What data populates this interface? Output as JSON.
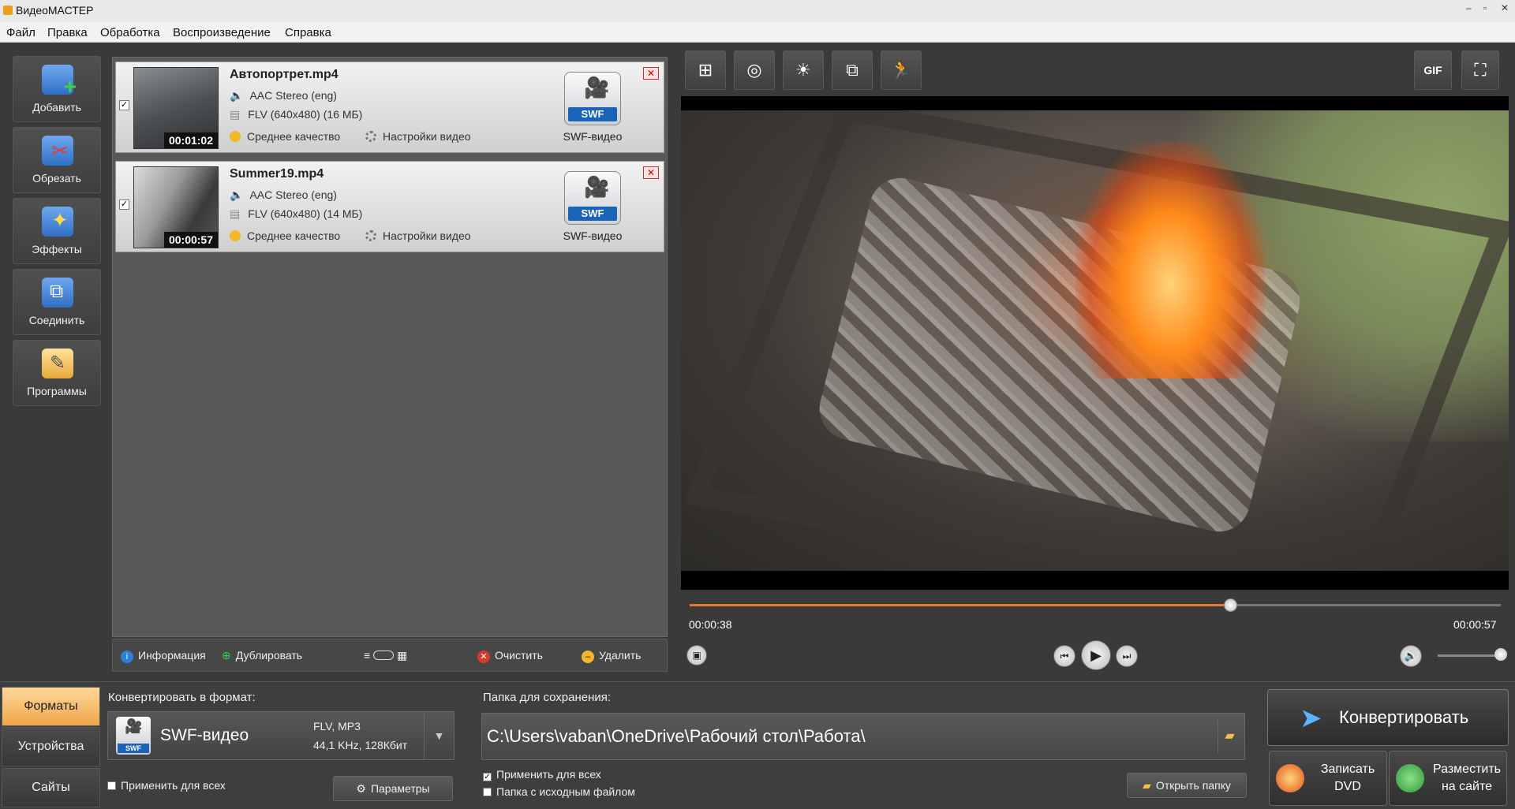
{
  "window": {
    "title": "ВидеоМАСТЕР",
    "controls": [
      "–",
      "▫",
      "✕"
    ]
  },
  "menu": [
    "Файл",
    "Правка",
    "Обработка",
    "Воспроизведение",
    "Справка"
  ],
  "sidebar": [
    {
      "label": "Добавить",
      "icon": "add-video-icon",
      "color": "#3f7fd6"
    },
    {
      "label": "Обрезать",
      "icon": "scissors-icon",
      "color": "#c0392b"
    },
    {
      "label": "Эффекты",
      "icon": "magic-wand-icon",
      "color": "#e0b43a"
    },
    {
      "label": "Соединить",
      "icon": "join-icon",
      "color": "#3f7fd6"
    },
    {
      "label": "Программы",
      "icon": "programs-icon",
      "color": "#f0c040"
    }
  ],
  "files": [
    {
      "name": "Автопортрет.mp4",
      "duration": "00:01:02",
      "audio": "AAC Stereo (eng)",
      "video": "FLV (640x480) (16 МБ)",
      "quality": "Среднее качество",
      "settings": "Настройки видео",
      "format_badge": "SWF",
      "format_label": "SWF-видео",
      "checked": "✓"
    },
    {
      "name": "Summer19.mp4",
      "duration": "00:00:57",
      "audio": "AAC Stereo (eng)",
      "video": "FLV (640x480) (14 МБ)",
      "quality": "Среднее качество",
      "settings": "Настройки видео",
      "format_badge": "SWF",
      "format_label": "SWF-видео",
      "checked": "✓"
    }
  ],
  "listbar": {
    "info": "Информация",
    "duplicate": "Дублировать",
    "clear": "Очистить",
    "delete": "Удалить"
  },
  "player": {
    "tools": [
      "⊞",
      "◎",
      "☀",
      "⧉",
      "🏃"
    ],
    "gif": "GIF",
    "current_time": "00:00:38",
    "total_time": "00:00:57",
    "progress": 0.666,
    "volume": 0.95,
    "accent": "#e87a2f"
  },
  "bottom": {
    "tabs": [
      "Форматы",
      "Устройства",
      "Сайты"
    ],
    "convert_to_label": "Конвертировать в формат:",
    "format_name": "SWF-видео",
    "format_badge": "SWF",
    "format_details1": "FLV, MP3",
    "format_details2": "44,1 KHz, 128Кбит",
    "apply_all": "Применить для всех",
    "params": "Параметры",
    "save_folder_label": "Папка для сохранения:",
    "save_path": "C:\\Users\\vaban\\OneDrive\\Рабочий стол\\Работа\\",
    "apply_all2": "Применить для всех",
    "source_folder": "Папка с исходным файлом",
    "open_folder": "Открыть папку",
    "convert": "Конвертировать",
    "burn_dvd1": "Записать",
    "burn_dvd2": "DVD",
    "publish1": "Разместить",
    "publish2": "на сайте"
  }
}
